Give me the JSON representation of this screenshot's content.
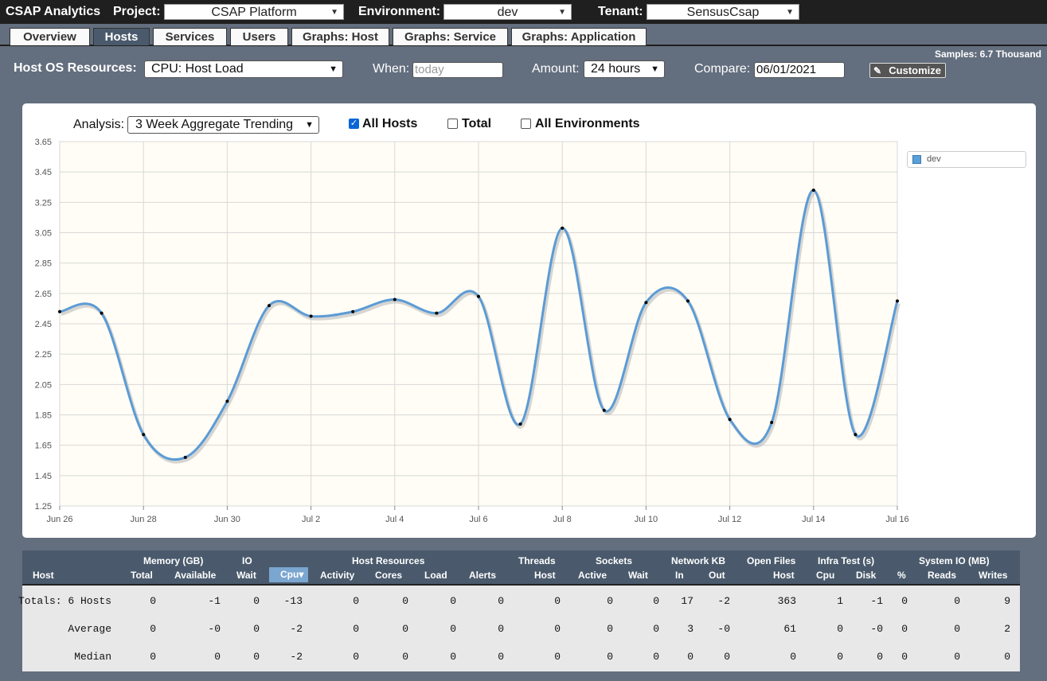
{
  "topbar": {
    "app_title": "CSAP Analytics",
    "project_label": "Project:",
    "project_value": "CSAP Platform",
    "environment_label": "Environment:",
    "environment_value": "dev",
    "tenant_label": "Tenant:",
    "tenant_value": "SensusCsap"
  },
  "tabs": [
    {
      "label": "Overview",
      "active": false
    },
    {
      "label": "Hosts",
      "active": true
    },
    {
      "label": "Services",
      "active": false
    },
    {
      "label": "Users",
      "active": false
    },
    {
      "label": "Graphs: Host",
      "active": false
    },
    {
      "label": "Graphs: Service",
      "active": false
    },
    {
      "label": "Graphs: Application",
      "active": false
    }
  ],
  "toolbar": {
    "resource_label": "Host OS Resources:",
    "resource_value": "CPU: Host Load",
    "when_label": "When:",
    "when_placeholder": "today",
    "amount_label": "Amount:",
    "amount_value": "24 hours",
    "compare_label": "Compare:",
    "compare_value": "06/01/2021",
    "customize_label": "Customize",
    "samples_text": "Samples: 6.7 Thousand"
  },
  "analysis": {
    "label": "Analysis:",
    "value": "3 Week Aggregate Trending",
    "all_hosts_label": "All Hosts",
    "all_hosts_checked": true,
    "total_label": "Total",
    "total_checked": false,
    "all_env_label": "All Environments",
    "all_env_checked": false
  },
  "colors": {
    "line": "#5b9bd5",
    "plot_bg": "#fffdf5",
    "header_bg": "#4a5a6c",
    "active_tab": "#4a5a6c"
  },
  "chart_data": {
    "type": "line",
    "x": [
      "Jun 26",
      "Jun 27",
      "Jun 28",
      "Jun 29",
      "Jun 30",
      "Jul 1",
      "Jul 2",
      "Jul 3",
      "Jul 4",
      "Jul 5",
      "Jul 6",
      "Jul 7",
      "Jul 8",
      "Jul 9",
      "Jul 10",
      "Jul 11",
      "Jul 12",
      "Jul 13",
      "Jul 14",
      "Jul 15",
      "Jul 16"
    ],
    "x_tick_labels": [
      "Jun 26",
      "Jun 28",
      "Jun 30",
      "Jul 2",
      "Jul 4",
      "Jul 6",
      "Jul 8",
      "Jul 10",
      "Jul 12",
      "Jul 14",
      "Jul 16"
    ],
    "y_ticks": [
      "3.65",
      "3.45",
      "3.25",
      "3.05",
      "2.85",
      "2.65",
      "2.45",
      "2.25",
      "2.05",
      "1.85",
      "1.65",
      "1.45",
      "1.25"
    ],
    "ylim": [
      1.25,
      3.65
    ],
    "series": [
      {
        "name": "dev",
        "values": [
          2.53,
          2.52,
          1.72,
          1.57,
          1.94,
          2.57,
          2.5,
          2.53,
          2.61,
          2.52,
          2.63,
          1.79,
          3.08,
          1.88,
          2.59,
          2.6,
          1.82,
          1.8,
          3.33,
          1.72,
          2.6
        ]
      }
    ],
    "grid": true,
    "legend": "right"
  },
  "table": {
    "groups": [
      "Memory (GB)",
      "IO",
      "Host Resources",
      "Threads",
      "Sockets",
      "Network KB",
      "Open Files",
      "Infra Test (s)",
      "System IO (MB)"
    ],
    "columns": [
      "Host",
      "Total",
      "Available",
      "Wait",
      "Cpu",
      "Activity",
      "Cores",
      "Load",
      "Alerts",
      "Host",
      "Active",
      "Wait",
      "In",
      "Out",
      "Host",
      "Cpu",
      "Disk",
      "%",
      "Reads",
      "Writes"
    ],
    "sort_indicator": "▾",
    "rows": [
      {
        "label": "Totals: 6 Hosts",
        "values": [
          "0",
          "-1",
          "0",
          "-13",
          "0",
          "0",
          "0",
          "0",
          "0",
          "0",
          "0",
          "17",
          "-2",
          "363",
          "1",
          "-1",
          "0",
          "0",
          "9"
        ]
      },
      {
        "label": "Average",
        "values": [
          "0",
          "-0",
          "0",
          "-2",
          "0",
          "0",
          "0",
          "0",
          "0",
          "0",
          "0",
          "3",
          "-0",
          "61",
          "0",
          "-0",
          "0",
          "0",
          "2"
        ]
      },
      {
        "label": "Median",
        "values": [
          "0",
          "0",
          "0",
          "-2",
          "0",
          "0",
          "0",
          "0",
          "0",
          "0",
          "0",
          "0",
          "0",
          "0",
          "0",
          "0",
          "0",
          "0",
          "0"
        ]
      }
    ]
  }
}
